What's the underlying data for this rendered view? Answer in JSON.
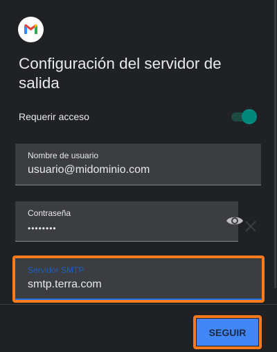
{
  "app": {
    "logo": "gmail-logo"
  },
  "header": {
    "title": "Configuración del servidor de salida"
  },
  "require_access": {
    "label": "Requerir acceso",
    "enabled": true,
    "accent": "#00897b"
  },
  "fields": {
    "username": {
      "label": "Nombre de usuario",
      "value": "usuario@midominio.com"
    },
    "password": {
      "label": "Contraseña",
      "value": "••••••••"
    },
    "smtp": {
      "label": "Servidor SMTP",
      "value": "smtp.terra.com",
      "focused": true
    }
  },
  "actions": {
    "next_label": "SEGUIR"
  },
  "colors": {
    "highlight": "#ff7a1a",
    "primary": "#4285f4",
    "background": "#202124"
  }
}
